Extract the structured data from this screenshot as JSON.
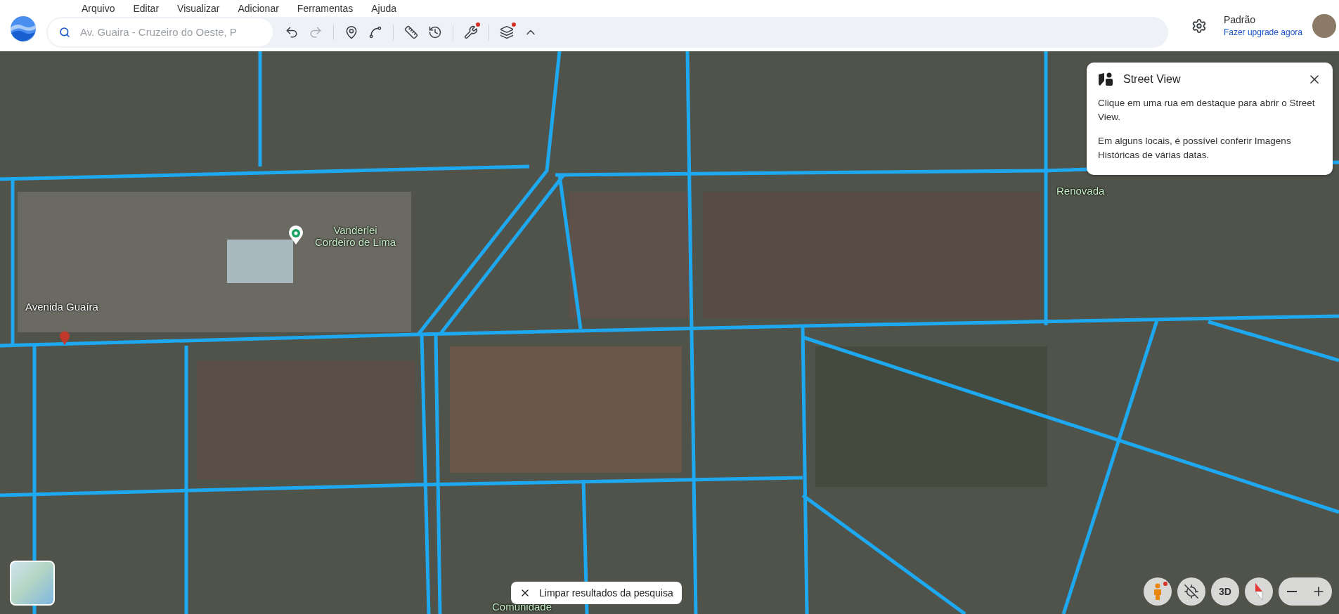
{
  "menu": [
    "Arquivo",
    "Editar",
    "Visualizar",
    "Adicionar",
    "Ferramentas",
    "Ajuda"
  ],
  "search": {
    "value": "Av. Guaira - Cruzeiro do Oeste, P"
  },
  "toolbar": [
    {
      "kind": "undo",
      "disabled": false,
      "dot": false
    },
    {
      "kind": "redo",
      "disabled": true,
      "dot": false
    },
    {
      "kind": "pin",
      "disabled": false,
      "dot": false
    },
    {
      "kind": "path",
      "disabled": false,
      "dot": false
    },
    {
      "kind": "ruler",
      "disabled": false,
      "dot": false
    },
    {
      "kind": "history",
      "disabled": false,
      "dot": false
    },
    {
      "kind": "tools",
      "disabled": false,
      "dot": true
    },
    {
      "kind": "layers",
      "disabled": false,
      "dot": true
    },
    {
      "kind": "collapse",
      "disabled": false,
      "dot": false
    }
  ],
  "account": {
    "plan": "Padrão",
    "upgrade": "Fazer upgrade agora"
  },
  "map_labels": [
    {
      "kind": "place",
      "text": "Vanderlei\nCordeiro de Lima"
    },
    {
      "kind": "street",
      "text": "Avenida Guaíra"
    },
    {
      "kind": "place",
      "text": "Renovada"
    },
    {
      "kind": "place",
      "text": "Comunidade"
    }
  ],
  "street_view_panel": {
    "title": "Street View",
    "paragraphs": [
      "Clique em uma rua em destaque para abrir o Street View.",
      "Em alguns locais, é possível conferir Imagens Históricas de várias datas."
    ]
  },
  "clear_button": "Limpar resultados da pesquisa",
  "map_controls": [
    {
      "kind": "pegman",
      "dot": true
    },
    {
      "kind": "tilt"
    },
    {
      "kind": "label",
      "text": "3D"
    },
    {
      "kind": "compass"
    }
  ]
}
